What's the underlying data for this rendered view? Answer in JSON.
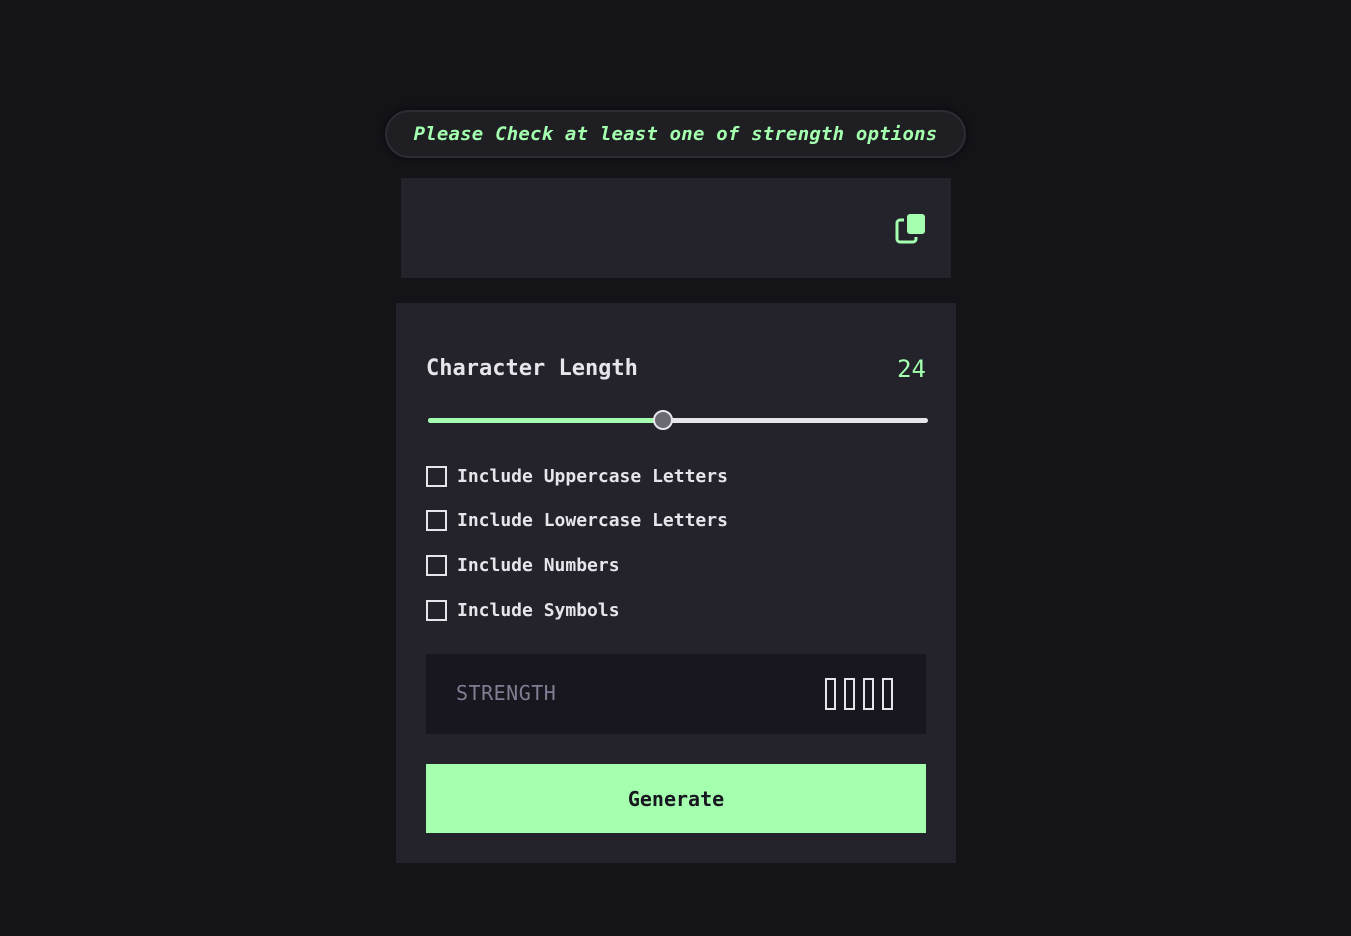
{
  "toast": {
    "message": "Please Check at least one of strength options"
  },
  "output": {
    "password": "",
    "copy_icon": "copy-icon"
  },
  "length": {
    "label": "Character Length",
    "value": "24",
    "fraction": 0.47
  },
  "options": [
    {
      "label": "Include Uppercase Letters",
      "checked": false
    },
    {
      "label": "Include Lowercase Letters",
      "checked": false
    },
    {
      "label": "Include Numbers",
      "checked": false
    },
    {
      "label": "Include Symbols",
      "checked": false
    }
  ],
  "strength": {
    "label": "STRENGTH",
    "level": 0,
    "bars": 4
  },
  "generate": {
    "label": "Generate"
  },
  "colors": {
    "accent": "#a4ffaf",
    "background": "#131318",
    "panel": "#24232c",
    "inset": "#18171f"
  }
}
